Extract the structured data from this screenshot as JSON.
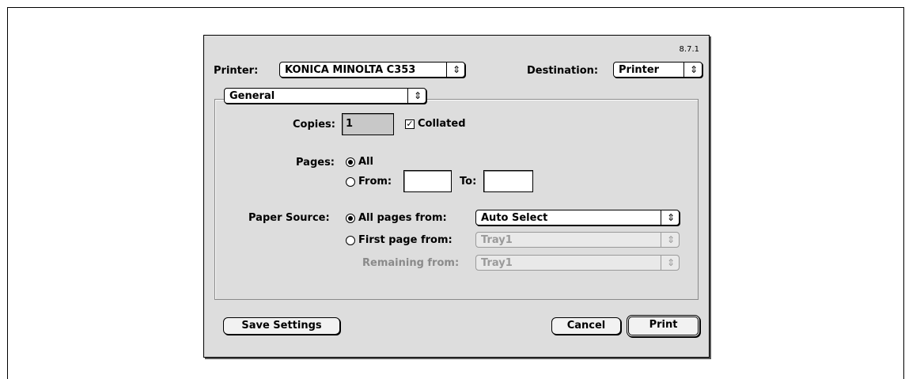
{
  "version": "8.7.1",
  "printer": {
    "label": "Printer:",
    "value": "KONICA MINOLTA C353"
  },
  "destination": {
    "label": "Destination:",
    "value": "Printer"
  },
  "panel": {
    "value": "General"
  },
  "copies": {
    "label": "Copies:",
    "value": "1",
    "collated_label": "Collated",
    "collated_checked": true
  },
  "pages": {
    "label": "Pages:",
    "all_label": "All",
    "from_label": "From:",
    "to_label": "To:",
    "from_value": "",
    "to_value": ""
  },
  "paper_source": {
    "label": "Paper Source:",
    "all_pages_label": "All pages from:",
    "all_pages_value": "Auto Select",
    "first_page_label": "First page from:",
    "first_page_value": "Tray1",
    "remaining_label": "Remaining from:",
    "remaining_value": "Tray1"
  },
  "buttons": {
    "save": "Save Settings",
    "cancel": "Cancel",
    "print": "Print"
  },
  "popup_arrow": "⇕"
}
